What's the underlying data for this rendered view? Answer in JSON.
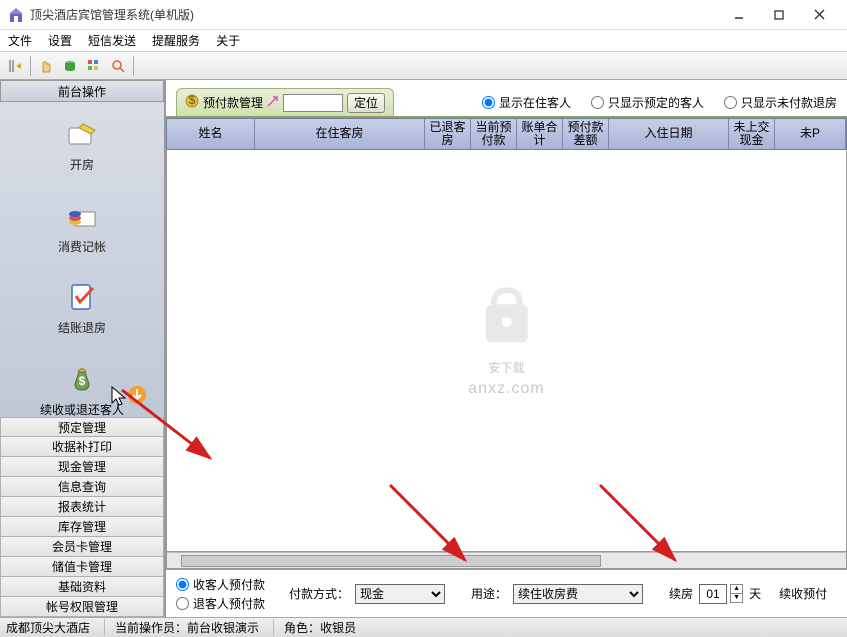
{
  "window": {
    "title": "顶尖酒店宾馆管理系统(单机版)"
  },
  "menu": {
    "file": "文件",
    "settings": "设置",
    "sms": "短信发送",
    "remind": "提醒服务",
    "about": "关于"
  },
  "sidebar": {
    "header": "前台操作",
    "items": [
      {
        "label": "开房"
      },
      {
        "label": "消费记帐"
      },
      {
        "label": "结账退房"
      },
      {
        "label": "续收或退还客人\n预付款"
      }
    ],
    "list": [
      "预定管理",
      "收据补打印",
      "现金管理",
      "信息查询",
      "报表统计",
      "库存管理",
      "会员卡管理",
      "储值卡管理",
      "基础资料",
      "帐号权限管理"
    ]
  },
  "tab": {
    "title": "预付款管理",
    "locate_btn": "定位"
  },
  "filter": {
    "opt1": "显示在住客人",
    "opt2": "只显示预定的客人",
    "opt3": "只显示未付款退房"
  },
  "grid": {
    "cols": [
      "姓名",
      "在住客房",
      "已退客房",
      "当前预付款",
      "账单合计",
      "预付款差额",
      "入住日期",
      "未上交现金",
      "未P"
    ]
  },
  "bottom": {
    "radio_a": "收客人预付款",
    "radio_b": "退客人预付款",
    "pay_label": "付款方式：",
    "pay_value": "现金",
    "purpose_label": "用途：",
    "purpose_value": "续住收房费",
    "renew_label": "续房",
    "renew_days": "01",
    "days_label": "天",
    "tail": "续收预付"
  },
  "watermark": {
    "main": "安下载",
    "sub": "anxz.com"
  },
  "status": {
    "hotel": "成都顶尖大酒店",
    "operator_lbl": "当前操作员：",
    "operator": "前台收银演示",
    "role_lbl": "角色：",
    "role": "收银员"
  }
}
